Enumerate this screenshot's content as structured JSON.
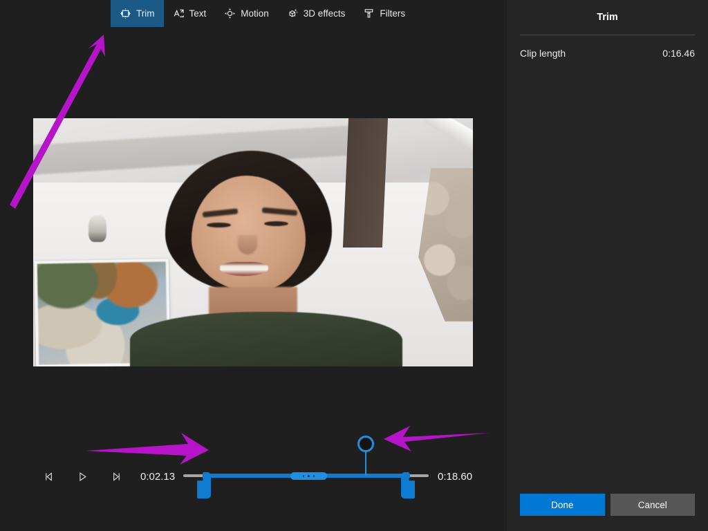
{
  "toolbar": {
    "tabs": [
      {
        "id": "trim",
        "label": "Trim",
        "icon": "trim-icon",
        "active": true
      },
      {
        "id": "text",
        "label": "Text",
        "icon": "text-icon",
        "active": false
      },
      {
        "id": "motion",
        "label": "Motion",
        "icon": "motion-icon",
        "active": false
      },
      {
        "id": "3d",
        "label": "3D effects",
        "icon": "cube-sparkle-icon",
        "active": false
      },
      {
        "id": "filters",
        "label": "Filters",
        "icon": "brush-icon",
        "active": false
      }
    ]
  },
  "transport": {
    "prev_frame_label": "Previous frame",
    "play_label": "Play",
    "next_frame_label": "Next frame",
    "current_time": "0:02.13",
    "end_time": "0:18.60"
  },
  "timeline": {
    "selection_start_pct": 8,
    "selection_end_pct": 92,
    "playhead_pct": 74,
    "grip_pct": 44
  },
  "panel": {
    "title": "Trim",
    "clip_length_label": "Clip length",
    "clip_length_value": "0:16.46",
    "done_label": "Done",
    "cancel_label": "Cancel"
  },
  "colors": {
    "accent": "#0078d4",
    "timeline_blue": "#0f7bd1",
    "grip_blue": "#1f8fe0",
    "annotation": "#b514c9",
    "window_bg": "#1f1f1f",
    "panel_bg": "#252525",
    "tab_active_bg": "#1b5a87"
  }
}
